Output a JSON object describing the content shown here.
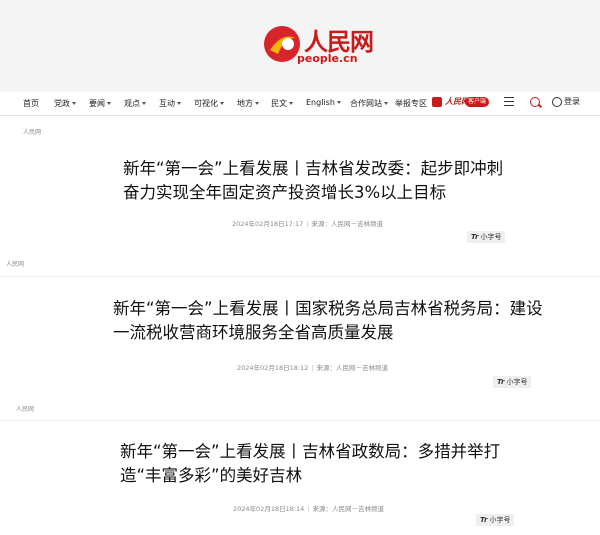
{
  "header": {
    "logo_cn": "人民网",
    "logo_en": "people.cn"
  },
  "nav": {
    "items": [
      {
        "label": "首页",
        "caret": false
      },
      {
        "label": "党政",
        "caret": true
      },
      {
        "label": "要闻",
        "caret": true
      },
      {
        "label": "观点",
        "caret": true
      },
      {
        "label": "互动",
        "caret": true
      },
      {
        "label": "可视化",
        "caret": true
      },
      {
        "label": "地方",
        "caret": true
      },
      {
        "label": "民文",
        "caret": true
      },
      {
        "label": "English",
        "caret": true
      },
      {
        "label": "合作网站",
        "caret": true
      },
      {
        "label": "举报专区",
        "caret": false
      }
    ],
    "app_brand": "人民网+",
    "app_badge": "客户端",
    "login_label": "登录"
  },
  "articles": [
    {
      "source_tag": "人民网",
      "title": "新年“第一会”上看发展丨吉林省发改委：起步即冲刺 奋力实现全年固定资产投资增长3%以上目标",
      "datetime": "2024年02月18日17:17",
      "source": "来源：人民网－吉林频道",
      "font_label": "小字号"
    },
    {
      "source_tag": "人民网",
      "title": "新年“第一会”上看发展丨国家税务总局吉林省税务局：建设一流税收营商环境服务全省高质量发展",
      "datetime": "2024年02月18日18:12",
      "source": "来源：人民网－吉林频道",
      "font_label": "小字号"
    },
    {
      "source_tag": "人民网",
      "title": "新年“第一会”上看发展丨吉林省政数局：多措并举打造“丰富多彩”的美好吉林",
      "datetime": "2024年02月18日18:14",
      "source": "来源：人民网－吉林频道",
      "font_label": "小字号"
    }
  ],
  "colors": {
    "brand": "#c81b1b",
    "header_bg": "#f4f4f4"
  }
}
